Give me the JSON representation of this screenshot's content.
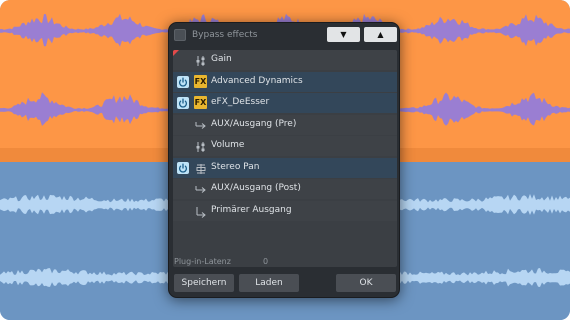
{
  "colors": {
    "top_track_bg": "#fd9646",
    "top_waveform": "#9a7ed2",
    "bottom_track_bg": "#6c95c2",
    "bottom_waveform": "#b7d6f3",
    "dialog_bg": "#2a2e33",
    "row_active": "#33475a",
    "row_inactive": "#3e4247",
    "fx_badge": "#e9b62f",
    "power_icon": "#bfe3f7"
  },
  "dialog": {
    "bypass_label": "Bypass effects",
    "move_down_icon": "triangle-down",
    "move_up_icon": "triangle-up",
    "chain": [
      {
        "label": "Gain",
        "icon": "fader-icon",
        "active": false,
        "power": false,
        "fx": false
      },
      {
        "label": "Advanced Dynamics",
        "icon": "fx-badge",
        "active": true,
        "power": true,
        "fx": true
      },
      {
        "label": "eFX_DeEsser",
        "icon": "fx-badge",
        "active": true,
        "power": true,
        "fx": true
      },
      {
        "label": "AUX/Ausgang (Pre)",
        "icon": "arrow-right-icon",
        "active": false,
        "power": false,
        "fx": false
      },
      {
        "label": "Volume",
        "icon": "fader-icon",
        "active": false,
        "power": false,
        "fx": false
      },
      {
        "label": "Stereo Pan",
        "icon": "pan-icon",
        "active": true,
        "power": true,
        "fx": false
      },
      {
        "label": "AUX/Ausgang (Post)",
        "icon": "arrow-right-icon",
        "active": false,
        "power": false,
        "fx": false
      },
      {
        "label": "Primärer Ausgang",
        "icon": "arrow-down-right-icon",
        "active": false,
        "power": false,
        "fx": false
      }
    ],
    "fx_text": "FX",
    "latency_label": "Plug-in-Latenz",
    "latency_value": "0",
    "save_label": "Speichern",
    "load_label": "Laden",
    "ok_label": "OK"
  }
}
